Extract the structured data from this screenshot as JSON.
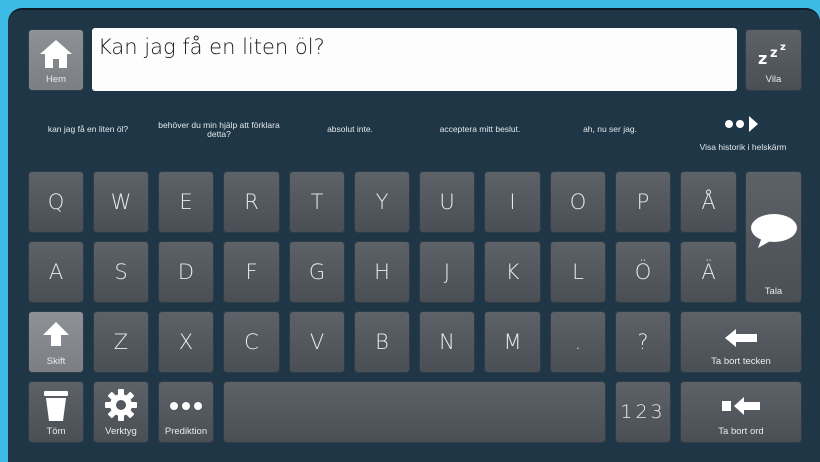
{
  "message": {
    "text": "Kan jag få en liten öl?"
  },
  "top_buttons": {
    "home_label": "Hem",
    "sleep_label": "Vila"
  },
  "predictions": [
    "kan jag få en liten öl?",
    "behöver du min hjälp att förklara detta?",
    "absolut inte.",
    "acceptera mitt beslut.",
    "ah, nu ser jag."
  ],
  "history": {
    "label": "Visa historik i helskärm"
  },
  "keys": {
    "row1": [
      "Q",
      "W",
      "E",
      "R",
      "T",
      "Y",
      "U",
      "I",
      "O",
      "P",
      "Å"
    ],
    "row2": [
      "A",
      "S",
      "D",
      "F",
      "G",
      "H",
      "J",
      "K",
      "L",
      "Ö",
      "Ä"
    ],
    "row3": [
      "Z",
      "X",
      "C",
      "V",
      "B",
      "N",
      "M",
      ".",
      "?"
    ],
    "numbers": "123"
  },
  "actions": {
    "speak": "Tala",
    "shift": "Skift",
    "delete_char": "Ta bort tecken",
    "clear": "Töm",
    "tools": "Verktyg",
    "prediction": "Prediktion",
    "delete_word": "Ta bort ord"
  },
  "icons": {
    "home": "home-icon",
    "sleep": "sleep-icon",
    "history": "dots-arrow-icon",
    "speak": "speech-bubble-icon",
    "shift": "arrow-up-icon",
    "delete_char": "arrow-left-icon",
    "clear": "trash-icon",
    "tools": "gear-icon",
    "prediction": "ellipsis-icon",
    "delete_word": "dot-arrow-left-icon"
  },
  "colors": {
    "background": "#3dbbe6",
    "panel": "#1f3646",
    "key": "#53585e",
    "text_box": "#fdfdfd"
  }
}
